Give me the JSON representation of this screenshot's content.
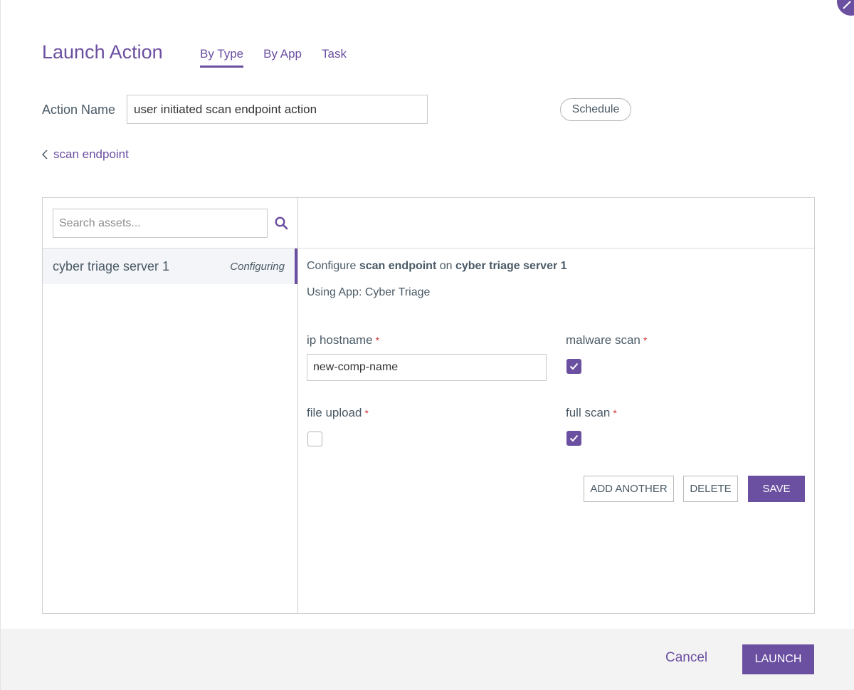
{
  "dialog": {
    "title": "Launch Action",
    "tabs": [
      {
        "label": "By Type",
        "active": true
      },
      {
        "label": "By App",
        "active": false
      },
      {
        "label": "Task",
        "active": false
      }
    ]
  },
  "action": {
    "label": "Action Name",
    "value": "user initiated scan endpoint action",
    "schedule_label": "Schedule"
  },
  "breadcrumb": {
    "back_label": "scan endpoint"
  },
  "assets": {
    "search_placeholder": "Search assets...",
    "items": [
      {
        "name": "cyber triage server 1",
        "status": "Configuring",
        "selected": true
      }
    ]
  },
  "config": {
    "prefix": "Configure",
    "action": "scan endpoint",
    "connector": "on",
    "asset": "cyber triage server 1",
    "using_app": "Using App: Cyber Triage",
    "required_mark": "*",
    "fields": {
      "ip_hostname": {
        "label": "ip hostname",
        "value": "new-comp-name"
      },
      "malware_scan": {
        "label": "malware scan",
        "checked": true
      },
      "file_upload": {
        "label": "file upload",
        "checked": false
      },
      "full_scan": {
        "label": "full scan",
        "checked": true
      }
    },
    "buttons": {
      "add_another": "ADD ANOTHER",
      "delete": "DELETE",
      "save": "SAVE"
    }
  },
  "footer": {
    "cancel_label": "Cancel",
    "launch_label": "LAUNCH"
  },
  "colors": {
    "accent": "#6b4fa0",
    "required": "#d03a3a",
    "text": "#4a5a66"
  }
}
